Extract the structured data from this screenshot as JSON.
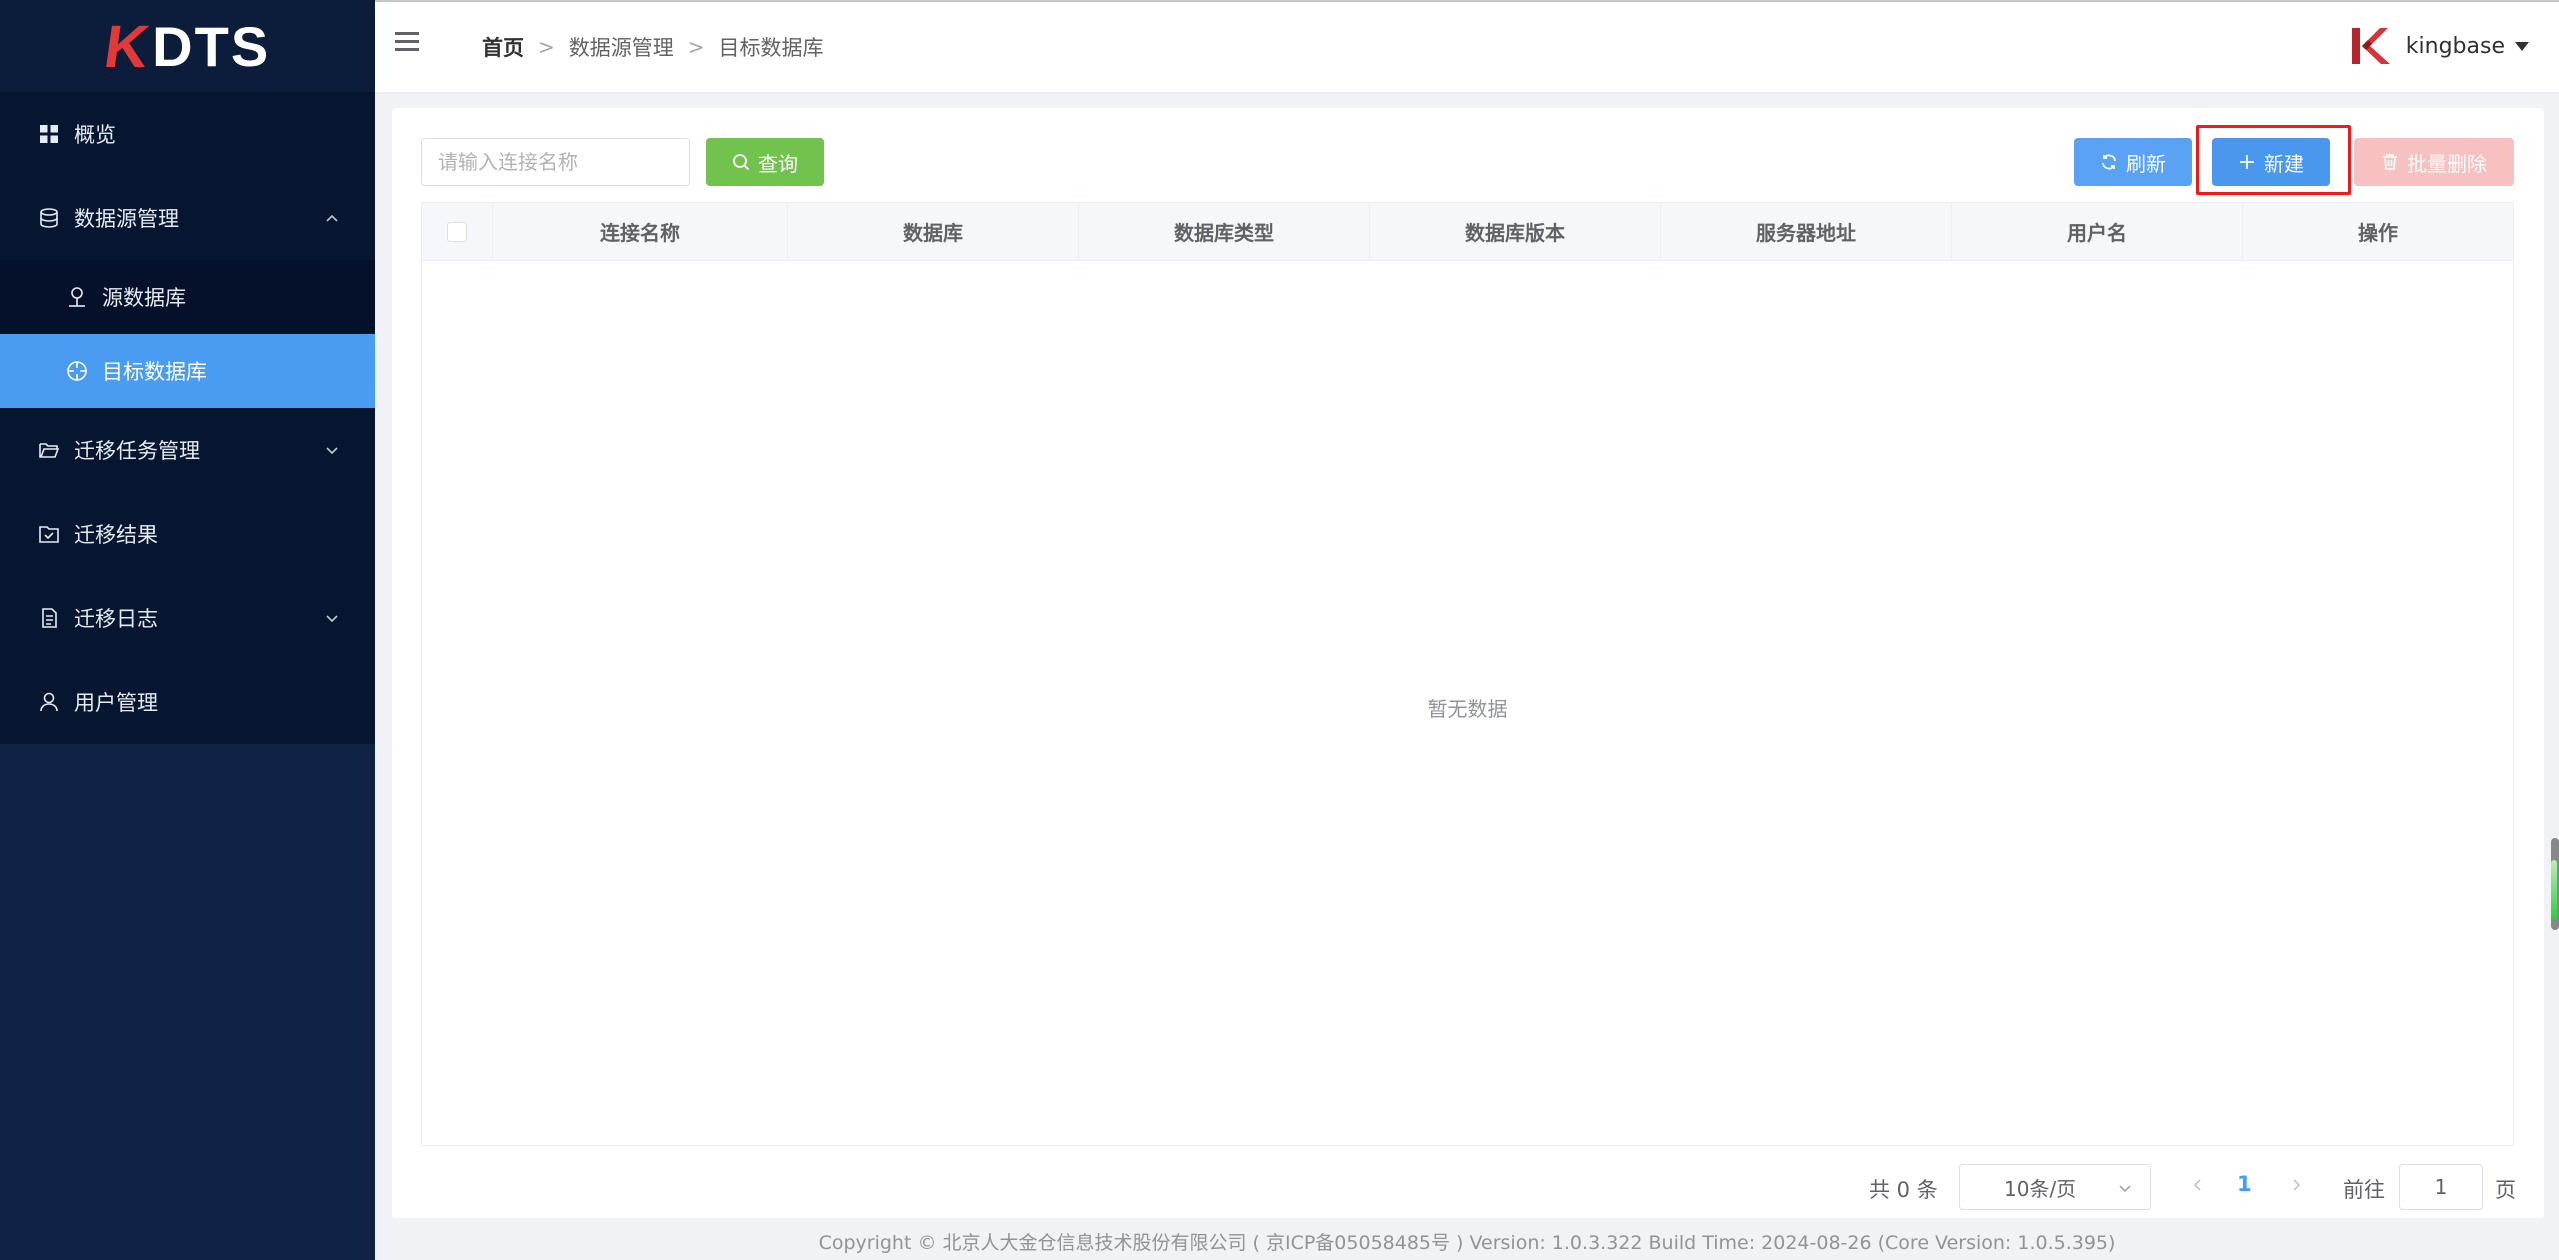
{
  "brand": {
    "logo_k": "K",
    "logo_rest": "DTS"
  },
  "sidebar": {
    "items": [
      {
        "label": "概览"
      },
      {
        "label": "数据源管理"
      },
      {
        "label": "源数据库"
      },
      {
        "label": "目标数据库"
      },
      {
        "label": "迁移任务管理"
      },
      {
        "label": "迁移结果"
      },
      {
        "label": "迁移日志"
      },
      {
        "label": "用户管理"
      }
    ]
  },
  "header": {
    "breadcrumb": [
      "首页",
      "数据源管理",
      "目标数据库"
    ],
    "username": "kingbase"
  },
  "toolbar": {
    "search_placeholder": "请输入连接名称",
    "query_label": "查询",
    "refresh_label": "刷新",
    "new_label": "新建",
    "batch_delete_label": "批量删除"
  },
  "table": {
    "columns": [
      "连接名称",
      "数据库",
      "数据库类型",
      "数据库版本",
      "服务器地址",
      "用户名",
      "操作"
    ],
    "empty_text": "暂无数据"
  },
  "pagination": {
    "total": "共 0 条",
    "page_size": "10条/页",
    "current_page": "1",
    "goto_label": "前往",
    "goto_value": "1",
    "goto_unit": "页"
  },
  "footer": {
    "copyright": "Copyright © 北京人大金仓信息技术股份有限公司 ( 京ICP备05058485号 ) Version: 1.0.3.322 Build Time: 2024-08-26 (Core Version: 1.0.5.395)"
  },
  "colors": {
    "sidebar_bg": "#0f2344",
    "active_item": "#4a9bf2",
    "query_button": "#72c24e",
    "primary_button": "#4a97ee",
    "danger_disabled": "#f7c1c1",
    "highlight_border": "#ee1b1b"
  }
}
